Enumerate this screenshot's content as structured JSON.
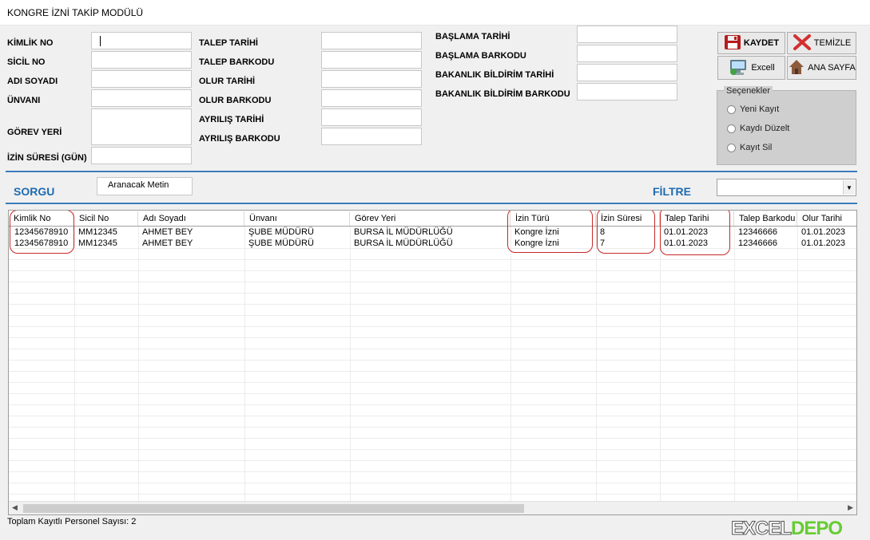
{
  "window": {
    "title": "KONGRE İZNİ TAKİP MODÜLÜ"
  },
  "form": {
    "col1": [
      {
        "label": "KİMLİK NO",
        "value": ""
      },
      {
        "label": "SİCİL NO",
        "value": ""
      },
      {
        "label": "ADI SOYADI",
        "value": ""
      },
      {
        "label": "ÜNVANI",
        "value": ""
      },
      {
        "label": "GÖREV YERİ",
        "value": ""
      },
      {
        "label": "İZİN SÜRESİ (GÜN)",
        "value": ""
      }
    ],
    "col2": [
      {
        "label": "TALEP TARİHİ",
        "value": ""
      },
      {
        "label": "TALEP BARKODU",
        "value": ""
      },
      {
        "label": "OLUR TARİHİ",
        "value": ""
      },
      {
        "label": "OLUR BARKODU",
        "value": ""
      },
      {
        "label": "AYRILIŞ TARİHİ",
        "value": ""
      },
      {
        "label": "AYRILIŞ BARKODU",
        "value": ""
      }
    ],
    "col3": [
      {
        "label": "BAŞLAMA TARİHİ",
        "value": ""
      },
      {
        "label": "BAŞLAMA BARKODU",
        "value": ""
      },
      {
        "label": "BAKANLIK BİLDİRİM TARİHİ",
        "value": ""
      },
      {
        "label": "BAKANLIK BİLDİRİM BARKODU",
        "value": ""
      }
    ]
  },
  "buttons": {
    "save": "KAYDET",
    "clear": "TEMİZLE",
    "excel": "Excell",
    "home": "ANA SAYFA"
  },
  "options": {
    "legend": "Seçenekler",
    "items": [
      "Yeni Kayıt",
      "Kaydı Düzelt",
      "Kayıt Sil"
    ]
  },
  "search": {
    "label": "SORGU",
    "value": "Aranacak Metin",
    "filter_label": "FİLTRE",
    "filter_value": ""
  },
  "table": {
    "columns": [
      "Kimlik No",
      "Sicil No",
      "Adı Soyadı",
      "Ünvanı",
      "Görev Yeri",
      "İzin Türü",
      "İzin Süresi",
      "Talep Tarihi",
      "Talep Barkodu",
      "Olur Tarihi"
    ],
    "rows": [
      [
        "12345678910",
        "MM12345",
        "AHMET BEY",
        "ŞUBE MÜDÜRÜ",
        "BURSA İL MÜDÜRLÜĞÜ",
        "Kongre İzni",
        "8",
        "01.01.2023",
        "12346666",
        "01.01.2023"
      ],
      [
        "12345678910",
        "MM12345",
        "AHMET BEY",
        "ŞUBE MÜDÜRÜ",
        "BURSA İL MÜDÜRLÜĞÜ",
        "Kongre İzni",
        "7",
        "01.01.2023",
        "12346666",
        "01.01.2023"
      ]
    ]
  },
  "status": {
    "text": "Toplam Kayıtlı Personel Sayısı: 2"
  },
  "brand": {
    "part1": "EXCEL",
    "part2": "DEPO"
  },
  "colors": {
    "accent": "#1e6bb0",
    "highlight": "#c62828",
    "brand_green": "#66cc33"
  }
}
